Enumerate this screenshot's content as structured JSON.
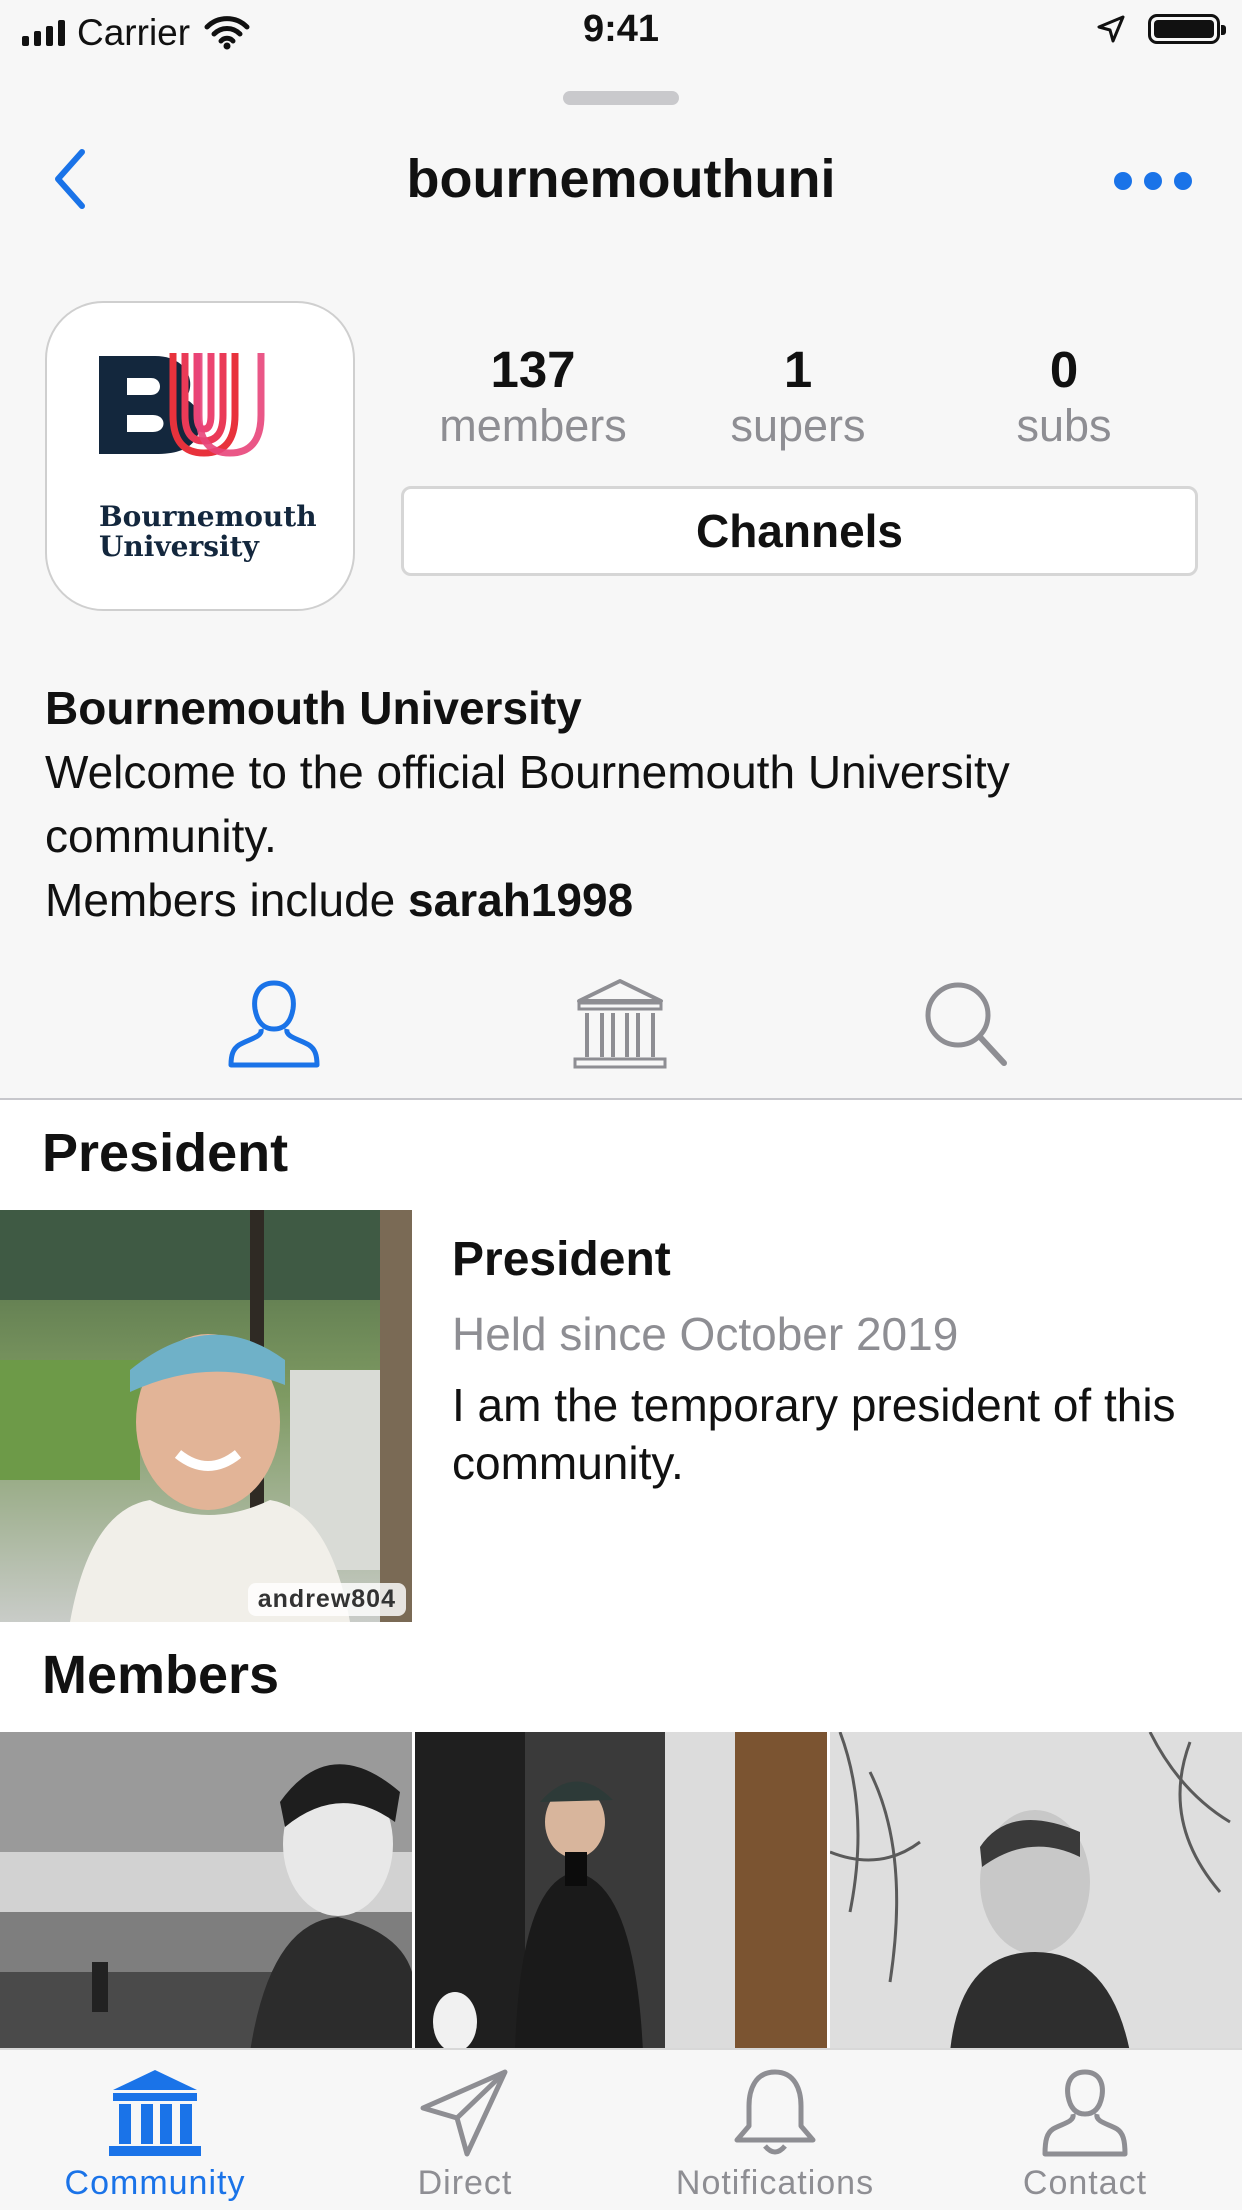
{
  "status_bar": {
    "carrier": "Carrier",
    "time": "9:41"
  },
  "nav": {
    "title": "bournemouthuni"
  },
  "logo": {
    "line1": "Bournemouth",
    "line2": "University",
    "letters": "BU"
  },
  "stats": [
    {
      "value": "137",
      "label": "members"
    },
    {
      "value": "1",
      "label": "supers"
    },
    {
      "value": "0",
      "label": "subs"
    }
  ],
  "channels_label": "Channels",
  "bio": {
    "name": "Bournemouth University",
    "text": "Welcome to the official Bournemouth University community.",
    "members_prefix": "Members include ",
    "members_user": "sarah1998"
  },
  "profile_tabs": [
    {
      "icon": "person-icon",
      "active": true
    },
    {
      "icon": "institution-icon",
      "active": false
    },
    {
      "icon": "search-icon",
      "active": false
    }
  ],
  "president_section": {
    "title": "President",
    "role": "President",
    "since": "Held since October 2019",
    "description": "I am the temporary president of this community.",
    "username": "andrew804"
  },
  "members_section": {
    "title": "Members"
  },
  "tab_bar": [
    {
      "label": "Community",
      "icon": "institution-icon",
      "active": true
    },
    {
      "label": "Direct",
      "icon": "paper-plane-icon",
      "active": false
    },
    {
      "label": "Notifications",
      "icon": "bell-icon",
      "active": false
    },
    {
      "label": "Contact",
      "icon": "person-icon",
      "active": false
    }
  ],
  "colors": {
    "accent": "#1a73e8",
    "inactive": "#8e8e93",
    "logo_navy": "#13273d",
    "logo_red": "#e8323c",
    "logo_pink": "#e8457a"
  }
}
